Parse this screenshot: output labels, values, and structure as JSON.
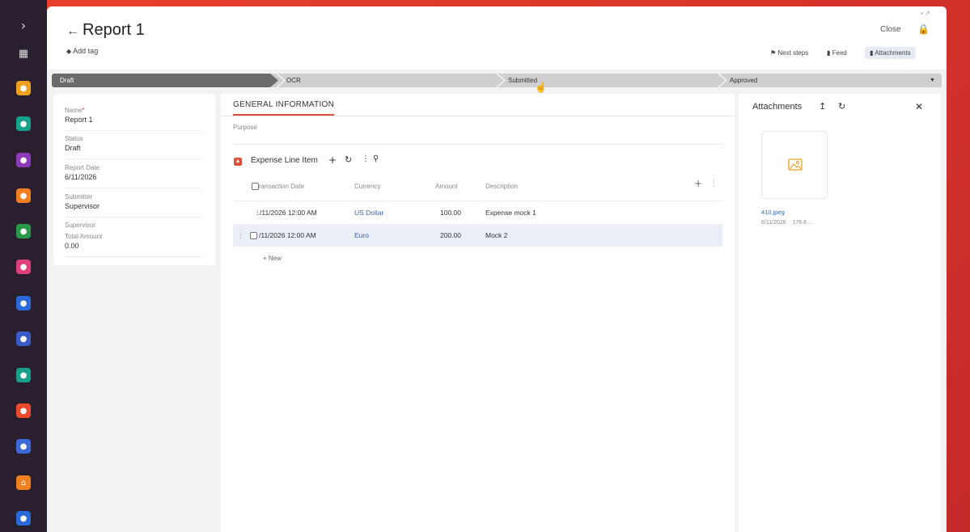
{
  "window": {
    "title": "Report 1",
    "add_tag": "Add tag",
    "close_label": "Close",
    "tabs": [
      {
        "label": "Next steps",
        "icon": "flag-icon"
      },
      {
        "label": "Feed",
        "icon": "chat-icon"
      },
      {
        "label": "Attachments",
        "icon": "paperclip-icon"
      }
    ]
  },
  "stages": [
    "Draft",
    "OCR",
    "Submitted",
    "Approved"
  ],
  "fields": [
    {
      "label": "Name",
      "required": "*",
      "value": "Report 1"
    },
    {
      "label": "Status",
      "value": "Draft"
    },
    {
      "label": "Report Date",
      "value": "6/11/2026"
    },
    {
      "label": "Submitter",
      "value": "Supervisor"
    },
    {
      "label": "Supervisor",
      "value": ""
    },
    {
      "label": "Total Amount",
      "value": "0.00"
    }
  ],
  "general": {
    "tab_label": "GENERAL INFORMATION",
    "purpose_label": "Purpose"
  },
  "lines": {
    "title": "Expense Line Item",
    "columns": [
      "ransaction Date",
      "Currency",
      "Amount",
      "Description"
    ],
    "rows": [
      {
        "prefix": "1",
        "date": "/11/2026 12:00 AM",
        "currency": "US Dollar",
        "amount": "100.00",
        "description": "Expense mock 1"
      },
      {
        "prefix": "",
        "date": "/11/2026 12:00 AM",
        "currency": "Euro",
        "amount": "200.00",
        "description": "Mock 2"
      }
    ],
    "new_label": "+ New"
  },
  "attachments": {
    "title": "Attachments",
    "file_name": "410.jpeg",
    "file_date": "6/11/2026",
    "file_size": "176.8 ..."
  },
  "colors": {
    "accent": "#e0503a",
    "link": "#3a63b8",
    "rail": "#2a1f2e"
  }
}
